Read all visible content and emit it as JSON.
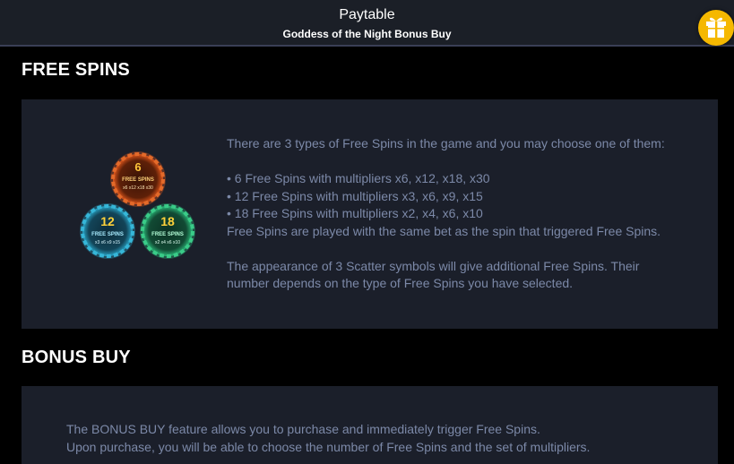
{
  "header": {
    "title": "Paytable",
    "subtitle": "Goddess of the Night Bonus Buy",
    "gift_icon": "gift-icon"
  },
  "free_spins": {
    "heading": "FREE SPINS",
    "chips": [
      {
        "number": "6",
        "label": "FREE SPINS",
        "multipliers": "x6 x12 x18 x30",
        "color": "#e0571c"
      },
      {
        "number": "12",
        "label": "FREE SPINS",
        "multipliers": "x3 x6 x9 x15",
        "color": "#2aa7c9"
      },
      {
        "number": "18",
        "label": "FREE SPINS",
        "multipliers": "x2 x4 x6 x10",
        "color": "#2cba7a"
      }
    ],
    "intro": "There are 3 types of Free Spins in the game and you may choose one of them:",
    "options": [
      "• 6 Free Spins with multipliers x6, x12, x18, x30",
      "• 12 Free Spins with multipliers x3, x6, x9, x15",
      "• 18 Free Spins with multipliers x2, x4, x6, x10"
    ],
    "bet_note": "Free Spins are played with the same bet as the spin that triggered Free Spins.",
    "scatter_line1": "The appearance of 3 Scatter symbols will give additional Free Spins. Their",
    "scatter_line2": "number depends on the type of Free Spins you have selected."
  },
  "bonus_buy": {
    "heading": "BONUS BUY",
    "line1": "The BONUS BUY feature allows you to purchase and immediately trigger Free Spins.",
    "line2": "Upon purchase, you will be able to choose the number of Free Spins and the set of multipliers."
  },
  "colors": {
    "background": "#000000",
    "panel": "#1b1f2a",
    "text": "#7c89a8",
    "gift": "#f5b800"
  }
}
